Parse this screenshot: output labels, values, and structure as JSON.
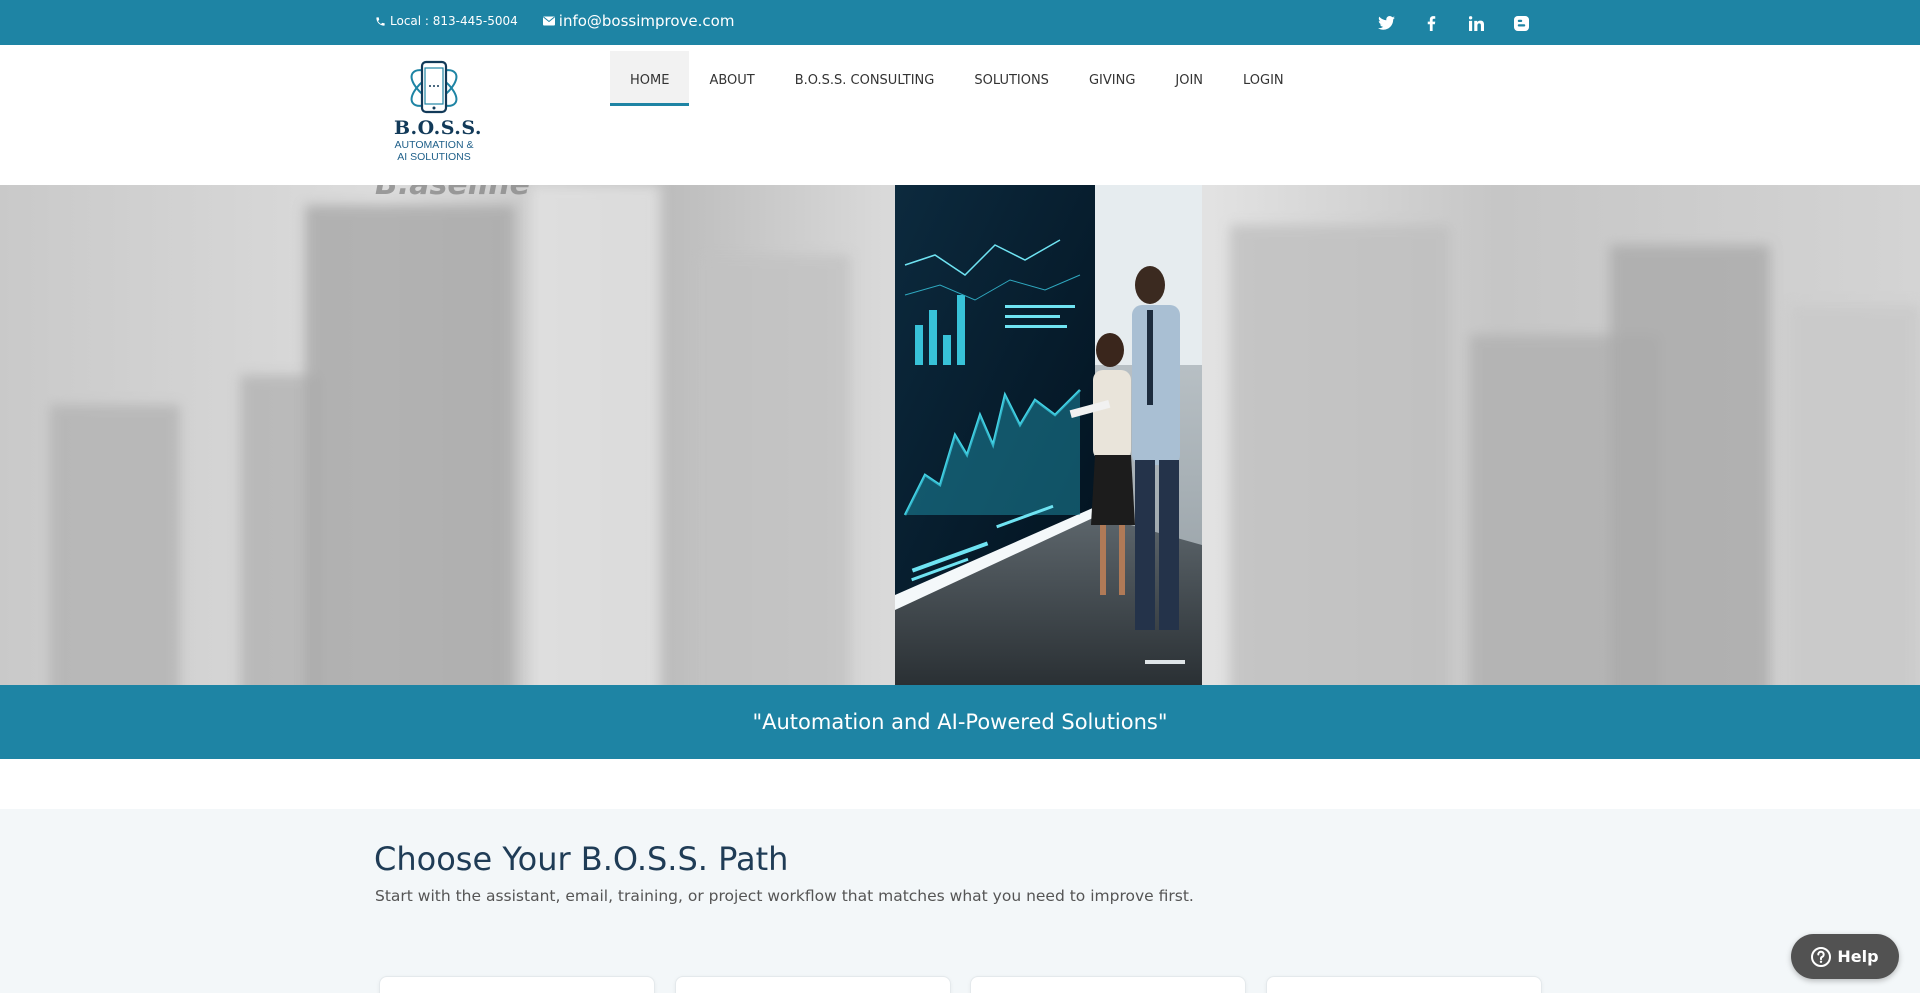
{
  "topbar": {
    "phone": "Local : 813-445-5004",
    "email": "info@bossimprove.com",
    "socials": [
      "twitter-icon",
      "facebook-icon",
      "linkedin-icon",
      "blogger-icon"
    ]
  },
  "logo": {
    "title": "B.O.S.S.",
    "subtitle_line1": "AUTOMATION &",
    "subtitle_line2": "AI SOLUTIONS"
  },
  "nav": {
    "items": [
      "HOME",
      "ABOUT",
      "B.O.S.S. CONSULTING",
      "SOLUTIONS",
      "GIVING",
      "JOIN",
      "LOGIN"
    ],
    "active": "HOME"
  },
  "hero": {
    "caption": "B.aseline"
  },
  "tagline": "\"Automation and AI-Powered Solutions\"",
  "path": {
    "heading": "Choose Your B.O.S.S. Path",
    "description": "Start with the assistant, email, training, or project workflow that matches what you need to improve first."
  },
  "help": {
    "label": "Help"
  },
  "colors": {
    "brand": "#1e84a4",
    "heading": "#1f3c56",
    "help_button": "#525252"
  }
}
